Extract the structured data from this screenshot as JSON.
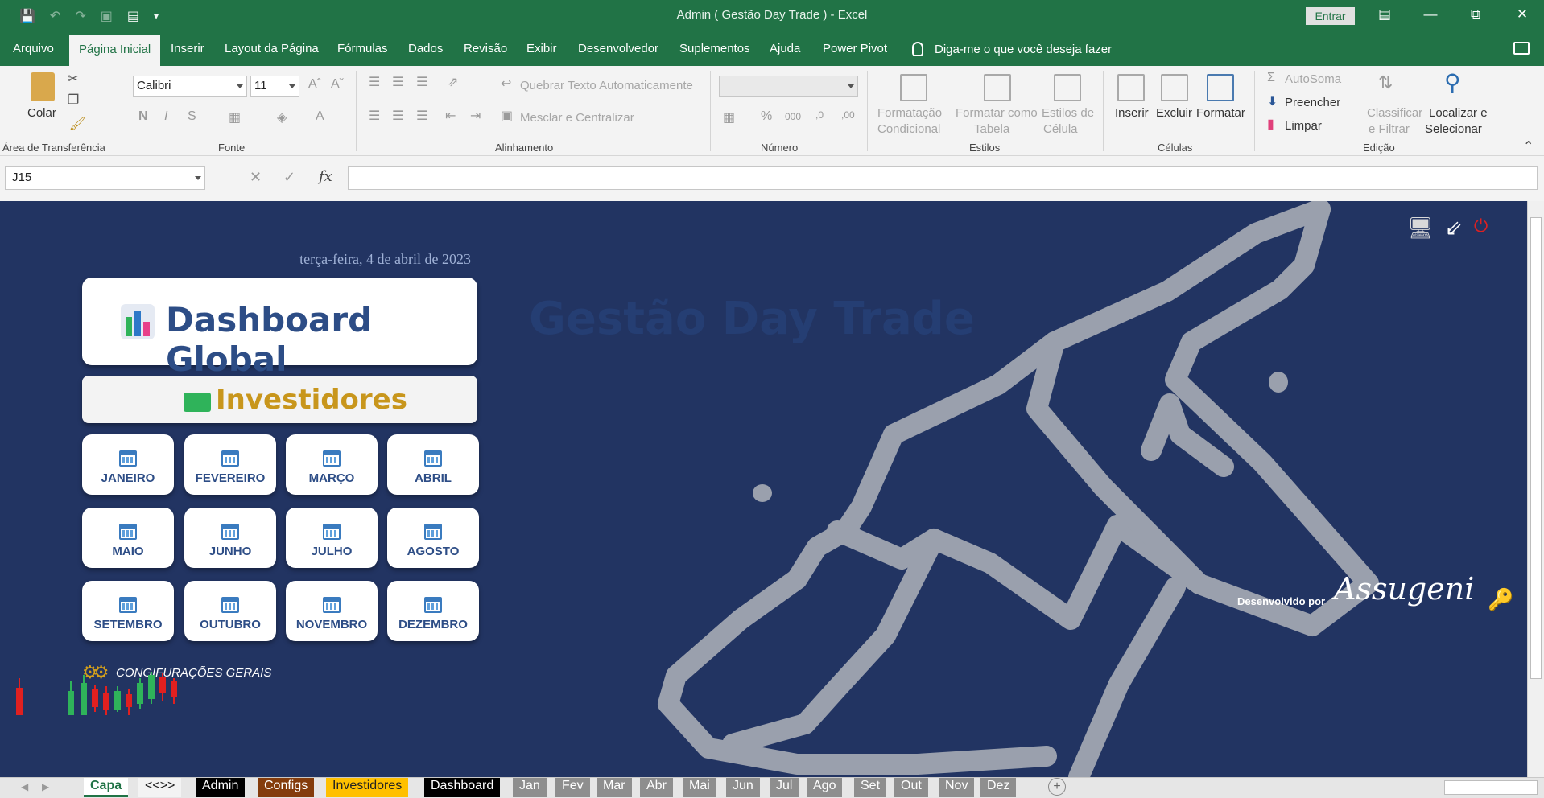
{
  "window": {
    "title": "Admin ( Gestão Day Trade )  -  Excel",
    "signin_label": "Entrar"
  },
  "menu": {
    "tabs": [
      "Arquivo",
      "Página Inicial",
      "Inserir",
      "Layout da Página",
      "Fórmulas",
      "Dados",
      "Revisão",
      "Exibir",
      "Desenvolvedor",
      "Suplementos",
      "Ajuda",
      "Power Pivot"
    ],
    "active_tab": "Página Inicial",
    "tell_me": "Diga-me o que você deseja fazer"
  },
  "ribbon": {
    "paste_label": "Colar",
    "clipboard_group": "Área de Transferência",
    "font_name": "Calibri",
    "font_size": "11",
    "font_group": "Fonte",
    "wrap_text": "Quebrar Texto Automaticamente",
    "merge_center": "Mesclar e Centralizar",
    "alignment_group": "Alinhamento",
    "number_group": "Número",
    "cond_format_1": "Formatação",
    "cond_format_2": "Condicional",
    "format_table_1": "Formatar como",
    "format_table_2": "Tabela",
    "cell_styles_1": "Estilos de",
    "cell_styles_2": "Célula",
    "styles_group": "Estilos",
    "insert": "Inserir",
    "delete": "Excluir",
    "format": "Formatar",
    "cells_group": "Células",
    "autosum": "AutoSoma",
    "fill": "Preencher",
    "clear": "Limpar",
    "sort_1": "Classificar",
    "sort_2": "e Filtrar",
    "find_1": "Localizar e",
    "find_2": "Selecionar",
    "editing_group": "Edição"
  },
  "formula_bar": {
    "name_box": "J15",
    "formula": ""
  },
  "sheet": {
    "date": "terça-feira, 4 de abril de 2023",
    "brand_title": "Gestão Day Trade",
    "dashboard_label": "Dashboard Global",
    "investidores_label": "Investidores",
    "months": [
      "JANEIRO",
      "FEVEREIRO",
      "MARÇO",
      "ABRIL",
      "MAIO",
      "JUNHO",
      "JULHO",
      "AGOSTO",
      "SETEMBRO",
      "OUTUBRO",
      "NOVEMBRO",
      "DEZEMBRO"
    ],
    "config_label": "CONGIFURAÇÕES GERAIS",
    "developed_by": "Desenvolvido por",
    "developer_signature": "Assugeni"
  },
  "sheet_tabs": [
    {
      "label": "Capa",
      "color": "#ffffff"
    },
    {
      "label": "<<>>",
      "color": "#f3f3f3"
    },
    {
      "label": "Admin",
      "color": "#000000"
    },
    {
      "label": "Configs",
      "color": "#843c0c"
    },
    {
      "label": "Investidores",
      "color": "#ffc000"
    },
    {
      "label": "Dashboard",
      "color": "#000000"
    },
    {
      "label": "Jan",
      "color": "#8e8e8e"
    },
    {
      "label": "Fev",
      "color": "#8e8e8e"
    },
    {
      "label": "Mar",
      "color": "#8e8e8e"
    },
    {
      "label": "Abr",
      "color": "#8e8e8e"
    },
    {
      "label": "Mai",
      "color": "#8e8e8e"
    },
    {
      "label": "Jun",
      "color": "#8e8e8e"
    },
    {
      "label": "Jul",
      "color": "#8e8e8e"
    },
    {
      "label": "Ago",
      "color": "#8e8e8e"
    },
    {
      "label": "Set",
      "color": "#8e8e8e"
    },
    {
      "label": "Out",
      "color": "#8e8e8e"
    },
    {
      "label": "Nov",
      "color": "#8e8e8e"
    },
    {
      "label": "Dez",
      "color": "#8e8e8e"
    }
  ],
  "colors": {
    "excel_green": "#217346",
    "sheet_bg": "#223462",
    "bull_outline": "#9aa0ad",
    "accent_gold": "#c8961c"
  }
}
